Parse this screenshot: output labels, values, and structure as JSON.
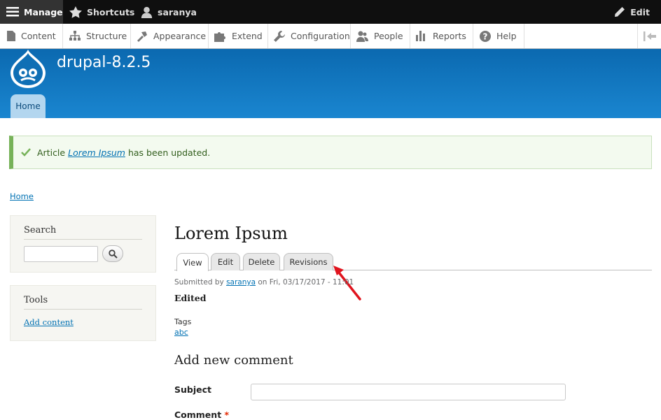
{
  "toolbar": {
    "manage_label": "Manage",
    "shortcuts_label": "Shortcuts",
    "user_label": "saranya",
    "edit_label": "Edit"
  },
  "tray": {
    "items": [
      {
        "label": "Content",
        "icon": "content-icon"
      },
      {
        "label": "Structure",
        "icon": "structure-icon"
      },
      {
        "label": "Appearance",
        "icon": "appearance-icon"
      },
      {
        "label": "Extend",
        "icon": "extend-icon"
      },
      {
        "label": "Configuration",
        "icon": "configuration-icon"
      },
      {
        "label": "People",
        "icon": "people-icon"
      },
      {
        "label": "Reports",
        "icon": "reports-icon"
      },
      {
        "label": "Help",
        "icon": "help-icon"
      }
    ]
  },
  "header": {
    "site_name": "drupal-8.2.5",
    "home_tab": "Home"
  },
  "status": {
    "prefix": "Article",
    "link": "Lorem Ipsum",
    "suffix": "has been updated."
  },
  "breadcrumb": {
    "home": "Home"
  },
  "sidebar": {
    "search_title": "Search",
    "tools_title": "Tools",
    "add_content": "Add content"
  },
  "article": {
    "title": "Lorem Ipsum",
    "tabs": [
      "View",
      "Edit",
      "Delete",
      "Revisions"
    ],
    "submitted_prefix": "Submitted by",
    "author": "saranya",
    "submitted_suffix": "on Fri, 03/17/2017 - 11:01",
    "body": "Edited",
    "tags_label": "Tags",
    "tag": "abc"
  },
  "comment": {
    "heading": "Add new comment",
    "subject_label": "Subject",
    "comment_label": "Comment",
    "required_mark": "*"
  },
  "colors": {
    "header_blue": "#0b69b0",
    "link_blue": "#0071b3",
    "status_green": "#77b259",
    "annotation_arrow": "#e0141e"
  }
}
